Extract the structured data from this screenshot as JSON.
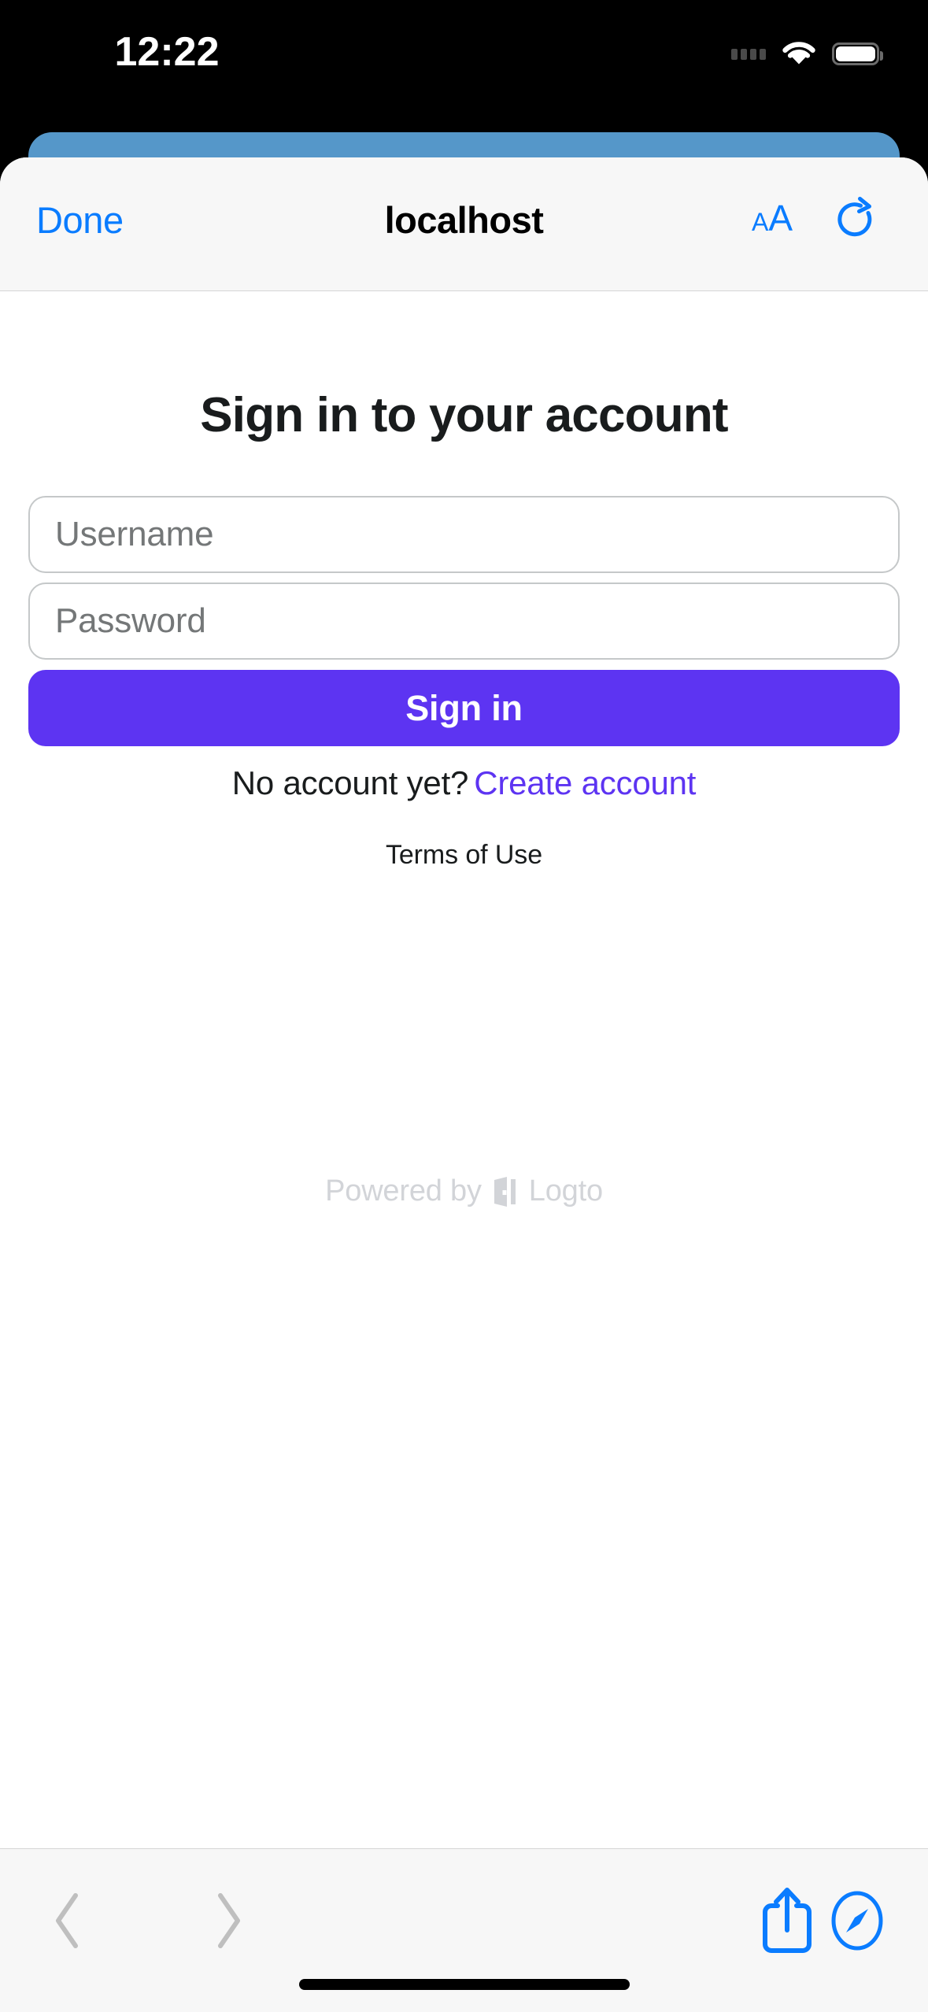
{
  "status_bar": {
    "time": "12:22",
    "cellular_icon": "cellular-dots-icon",
    "wifi_icon": "wifi-icon",
    "battery_icon": "battery-full-icon"
  },
  "browser": {
    "navbar": {
      "done_label": "Done",
      "title": "localhost",
      "text_size_label_small": "A",
      "text_size_label_large": "A",
      "text_size_icon": "text-size-icon",
      "reload_icon": "reload-icon"
    },
    "toolbar": {
      "back_icon": "chevron-left-icon",
      "forward_icon": "chevron-right-icon",
      "share_icon": "share-icon",
      "tabs_icon": "safari-compass-icon"
    }
  },
  "page": {
    "title": "Sign in to your account",
    "username": {
      "placeholder": "Username",
      "value": ""
    },
    "password": {
      "placeholder": "Password",
      "value": ""
    },
    "signin_label": "Sign in",
    "no_account_text": "No account yet?",
    "create_account_label": "Create account",
    "terms_label": "Terms of Use",
    "powered_by_text": "Powered by",
    "powered_by_brand": "Logto"
  },
  "colors": {
    "accent_purple": "#5d34f2",
    "link_blue": "#0a7cff",
    "card_blue": "#5597c9",
    "placeholder_gray": "#747778",
    "footer_gray": "#d2d4d8",
    "toolbar_bg": "#f7f7f7"
  }
}
